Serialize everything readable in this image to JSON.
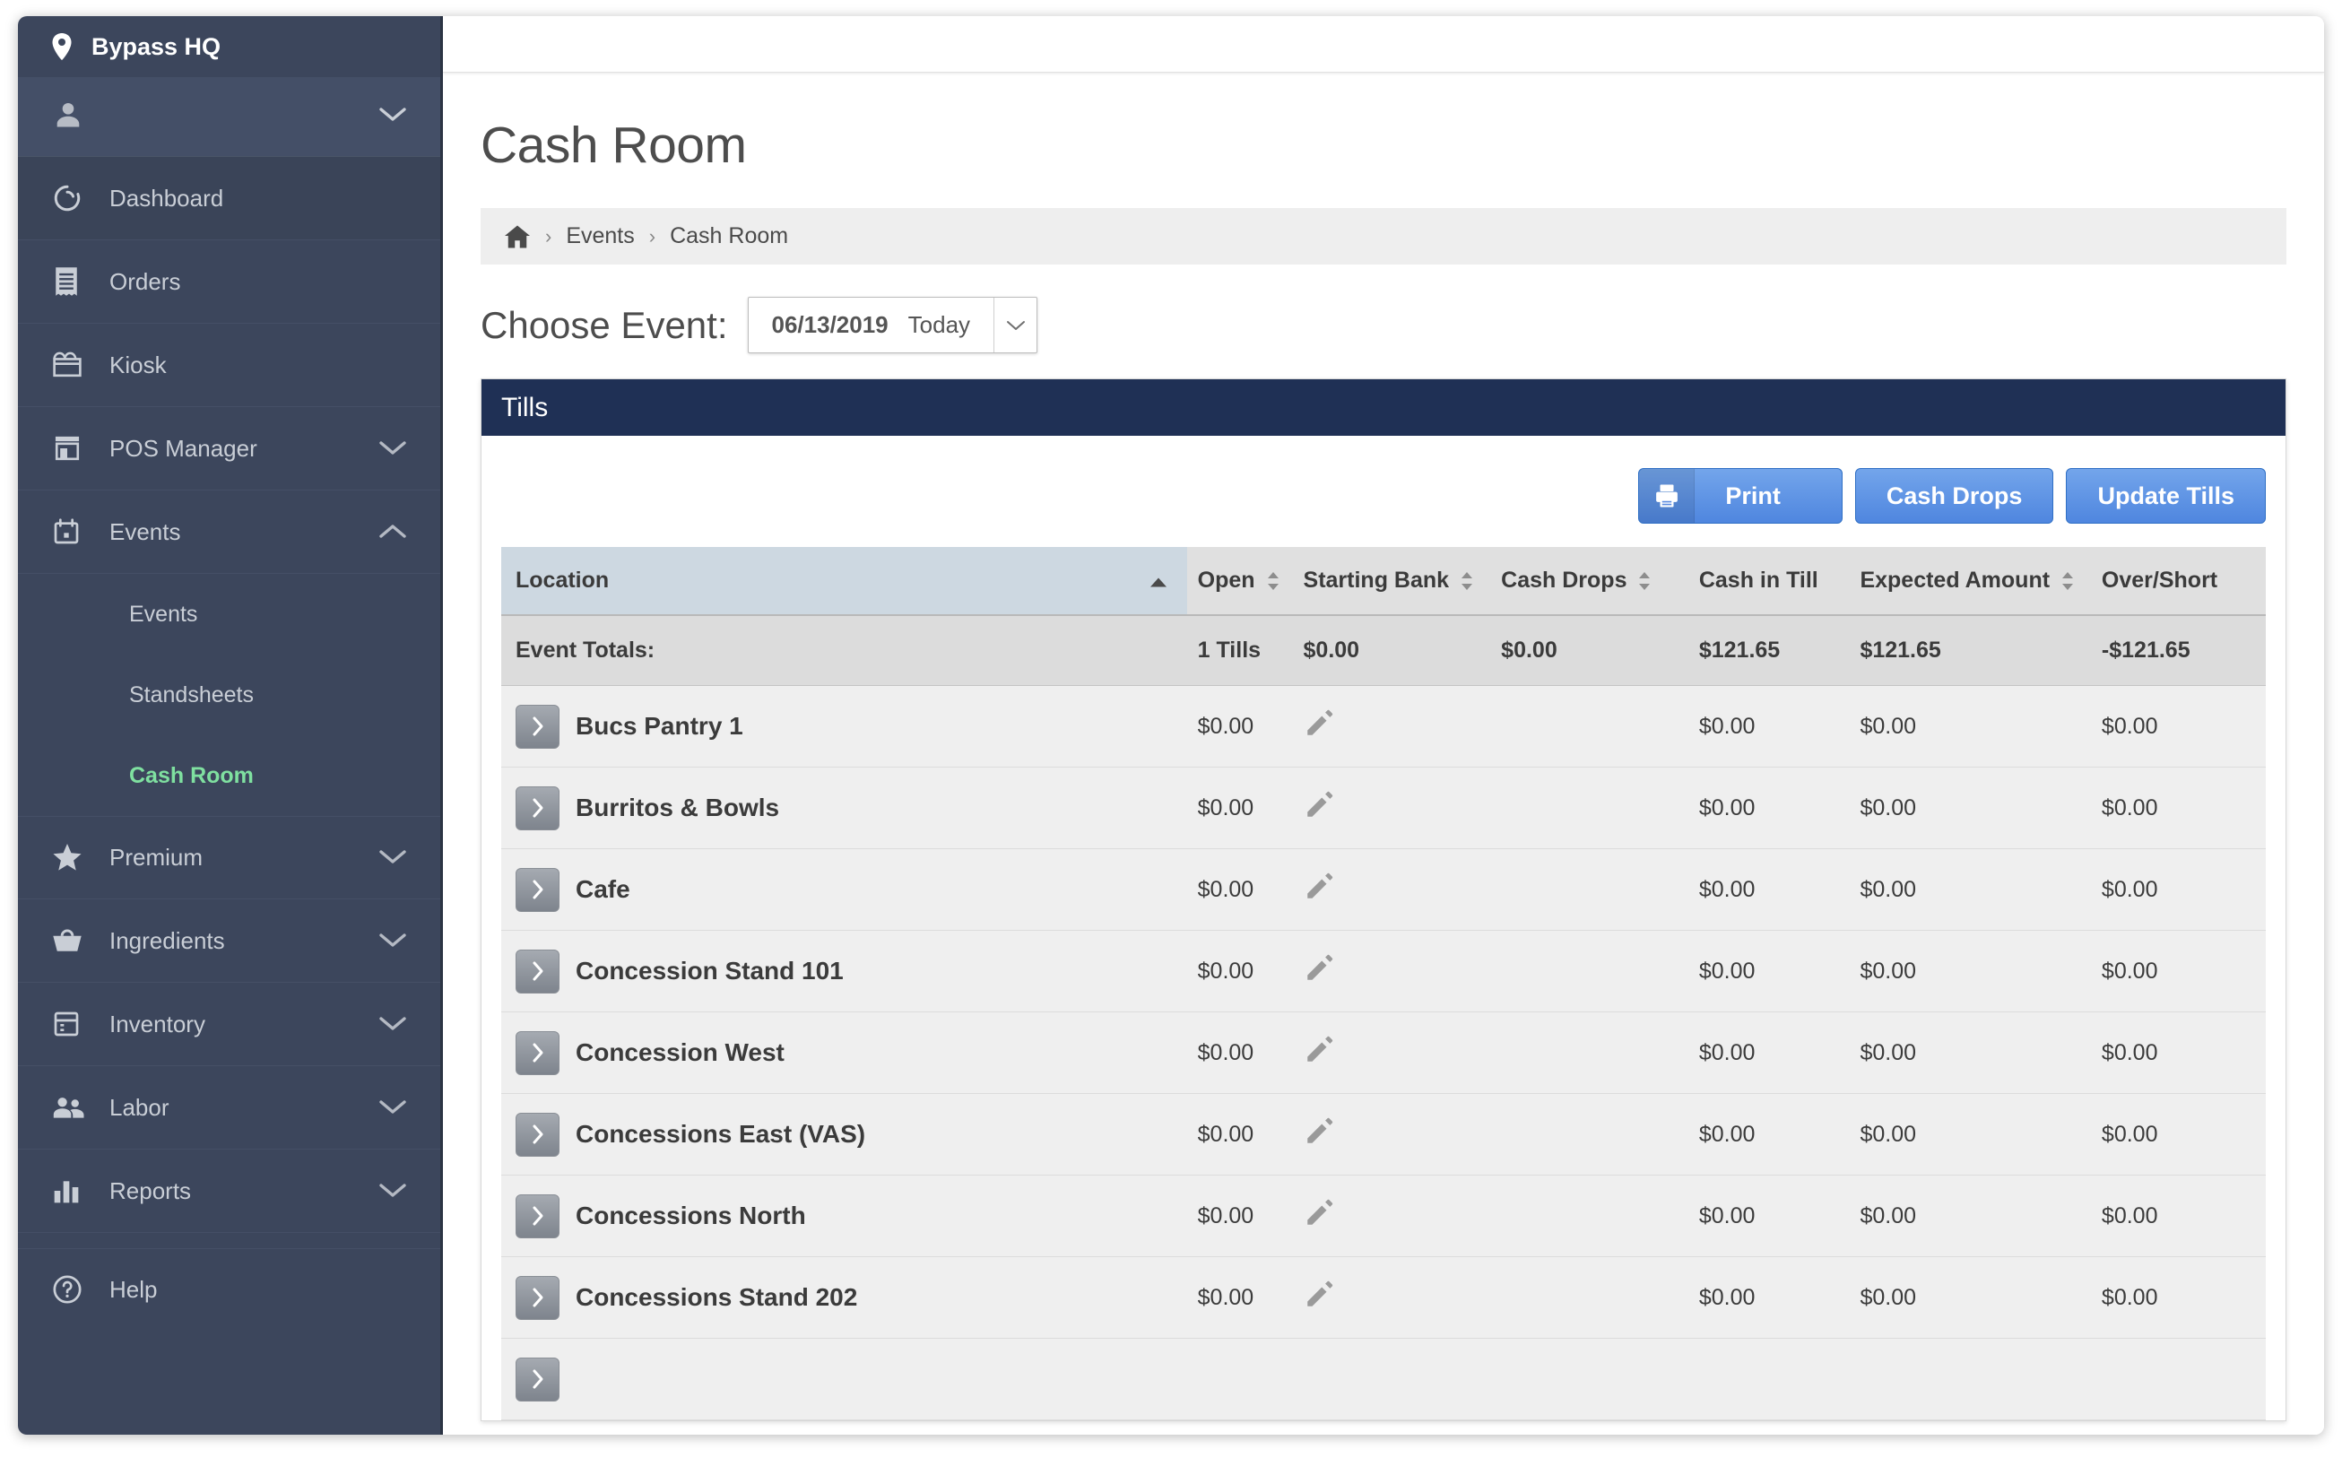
{
  "sidebar": {
    "brand": "Bypass HQ",
    "brand_icon": "location-pin-icon",
    "user_icon": "user-icon",
    "items": [
      {
        "label": "Dashboard",
        "icon": "dashboard-donut-icon",
        "caret": null,
        "active": true
      },
      {
        "label": "Orders",
        "icon": "receipt-icon",
        "caret": null,
        "active": false
      },
      {
        "label": "Kiosk",
        "icon": "storefront-awning-icon",
        "caret": null,
        "active": false
      },
      {
        "label": "POS Manager",
        "icon": "store-icon",
        "caret": "down",
        "active": false
      },
      {
        "label": "Events",
        "icon": "calendar-icon",
        "caret": "up",
        "active": false
      }
    ],
    "events_sub": [
      {
        "label": "Events",
        "current": false
      },
      {
        "label": "Standsheets",
        "current": false
      },
      {
        "label": "Cash Room",
        "current": true
      }
    ],
    "items_lower": [
      {
        "label": "Premium",
        "icon": "star-icon",
        "caret": "down"
      },
      {
        "label": "Ingredients",
        "icon": "basket-icon",
        "caret": "down"
      },
      {
        "label": "Inventory",
        "icon": "inventory-icon",
        "caret": "down"
      },
      {
        "label": "Labor",
        "icon": "people-icon",
        "caret": "down"
      },
      {
        "label": "Reports",
        "icon": "bar-chart-icon",
        "caret": "down"
      }
    ],
    "help": {
      "label": "Help",
      "icon": "help-circle-icon"
    }
  },
  "page": {
    "title": "Cash Room"
  },
  "breadcrumb": {
    "home_icon": "home-icon",
    "items": [
      "Events",
      "Cash Room"
    ],
    "separator": "›"
  },
  "event_picker": {
    "label": "Choose Event:",
    "date": "06/13/2019",
    "name": "Today",
    "caret_icon": "chevron-down-icon"
  },
  "panel": {
    "title": "Tills",
    "buttons": [
      {
        "label": "Print",
        "icon": "printer-icon"
      },
      {
        "label": "Cash Drops",
        "icon": null
      },
      {
        "label": "Update Tills",
        "icon": null
      }
    ]
  },
  "table": {
    "columns": [
      {
        "key": "location",
        "label": "Location",
        "sortable": true,
        "sorted": "asc"
      },
      {
        "key": "open",
        "label": "Open",
        "sortable": true
      },
      {
        "key": "bank",
        "label": "Starting Bank",
        "sortable": true
      },
      {
        "key": "drops",
        "label": "Cash Drops",
        "sortable": true
      },
      {
        "key": "till",
        "label": "Cash in Till",
        "sortable": false
      },
      {
        "key": "expected",
        "label": "Expected Amount",
        "sortable": true
      },
      {
        "key": "overshort",
        "label": "Over/Short",
        "sortable": false
      }
    ],
    "totals": {
      "label": "Event Totals:",
      "open": "1 Tills",
      "bank": "$0.00",
      "drops": "$0.00",
      "till": "$121.65",
      "expected": "$121.65",
      "overshort": "-$121.65"
    },
    "rows": [
      {
        "location": "Bucs Pantry 1",
        "open": "$0.00",
        "drops_icon": "pencil-icon",
        "till": "$0.00",
        "expected": "$0.00",
        "overshort": "$0.00"
      },
      {
        "location": "Burritos & Bowls",
        "open": "$0.00",
        "drops_icon": "pencil-icon",
        "till": "$0.00",
        "expected": "$0.00",
        "overshort": "$0.00"
      },
      {
        "location": "Cafe",
        "open": "$0.00",
        "drops_icon": "pencil-icon",
        "till": "$0.00",
        "expected": "$0.00",
        "overshort": "$0.00"
      },
      {
        "location": "Concession Stand 101",
        "open": "$0.00",
        "drops_icon": "pencil-icon",
        "till": "$0.00",
        "expected": "$0.00",
        "overshort": "$0.00"
      },
      {
        "location": "Concession West",
        "open": "$0.00",
        "drops_icon": "pencil-icon",
        "till": "$0.00",
        "expected": "$0.00",
        "overshort": "$0.00"
      },
      {
        "location": "Concessions East (VAS)",
        "open": "$0.00",
        "drops_icon": "pencil-icon",
        "till": "$0.00",
        "expected": "$0.00",
        "overshort": "$0.00"
      },
      {
        "location": "Concessions North",
        "open": "$0.00",
        "drops_icon": "pencil-icon",
        "till": "$0.00",
        "expected": "$0.00",
        "overshort": "$0.00"
      },
      {
        "location": "Concessions Stand 202",
        "open": "$0.00",
        "drops_icon": "pencil-icon",
        "till": "$0.00",
        "expected": "$0.00",
        "overshort": "$0.00"
      }
    ]
  },
  "colors": {
    "sidebar_bg": "#3c465c",
    "sidebar_user_bg": "#444f67",
    "sidebar_active_bg": "#3a4458",
    "sidebar_current_link": "#7fe0a0",
    "panel_header_bg": "#1f3055",
    "button_blue": "#4f86df",
    "negative_red": "#e8453c",
    "location_header_bg": "#cdd8e1",
    "table_header_bg": "#e0e0e0",
    "row_bg": "#efefef"
  }
}
